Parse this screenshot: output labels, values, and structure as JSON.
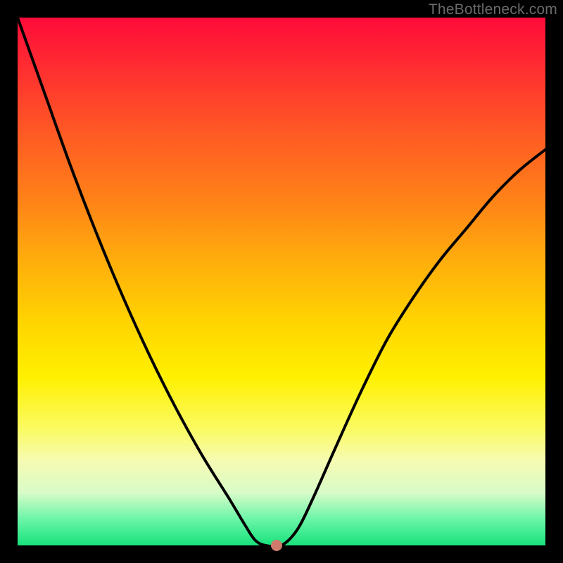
{
  "watermark": "TheBottleneck.com",
  "chart_data": {
    "type": "line",
    "title": "",
    "xlabel": "",
    "ylabel": "",
    "xlim": [
      0,
      1
    ],
    "ylim": [
      0,
      1
    ],
    "series": [
      {
        "name": "bottleneck-curve",
        "x": [
          0.0,
          0.05,
          0.1,
          0.15,
          0.2,
          0.25,
          0.3,
          0.35,
          0.4,
          0.43,
          0.45,
          0.47,
          0.5,
          0.53,
          0.56,
          0.6,
          0.65,
          0.7,
          0.75,
          0.8,
          0.85,
          0.9,
          0.95,
          1.0
        ],
        "y": [
          1.0,
          0.86,
          0.72,
          0.59,
          0.47,
          0.36,
          0.26,
          0.17,
          0.09,
          0.04,
          0.01,
          0.0,
          0.0,
          0.03,
          0.09,
          0.18,
          0.29,
          0.39,
          0.47,
          0.54,
          0.6,
          0.66,
          0.71,
          0.75
        ]
      }
    ],
    "annotations": [
      {
        "name": "minimum-marker",
        "x": 0.49,
        "y": 0.0
      }
    ],
    "background_gradient": {
      "top": "#ff0b3a",
      "mid": "#ffd500",
      "bottom": "#18e27c"
    }
  }
}
